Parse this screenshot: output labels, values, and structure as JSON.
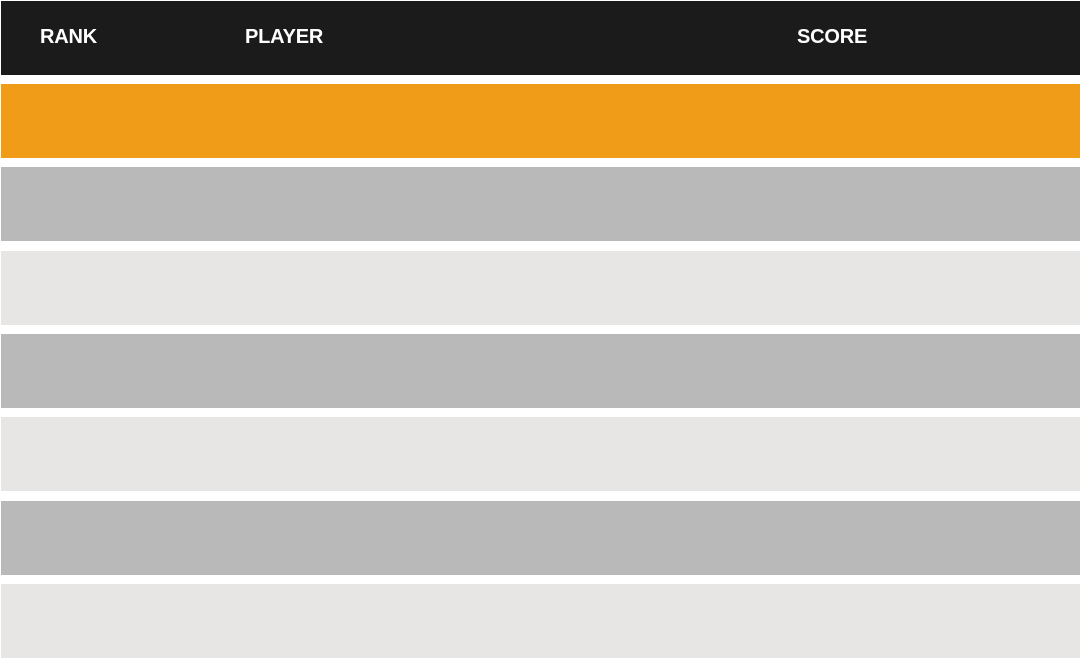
{
  "leaderboard": {
    "columns": {
      "rank": "RANK",
      "player": "PLAYER",
      "score": "SCORE"
    },
    "rows": [
      {
        "color": "#f09c18"
      },
      {
        "color": "#b9b9b9"
      },
      {
        "color": "#e7e6e4"
      },
      {
        "color": "#b9b9b9"
      },
      {
        "color": "#e7e6e4"
      },
      {
        "color": "#b9b9b9"
      },
      {
        "color": "#e7e6e4"
      }
    ],
    "header_color": "#1b1b1b"
  }
}
